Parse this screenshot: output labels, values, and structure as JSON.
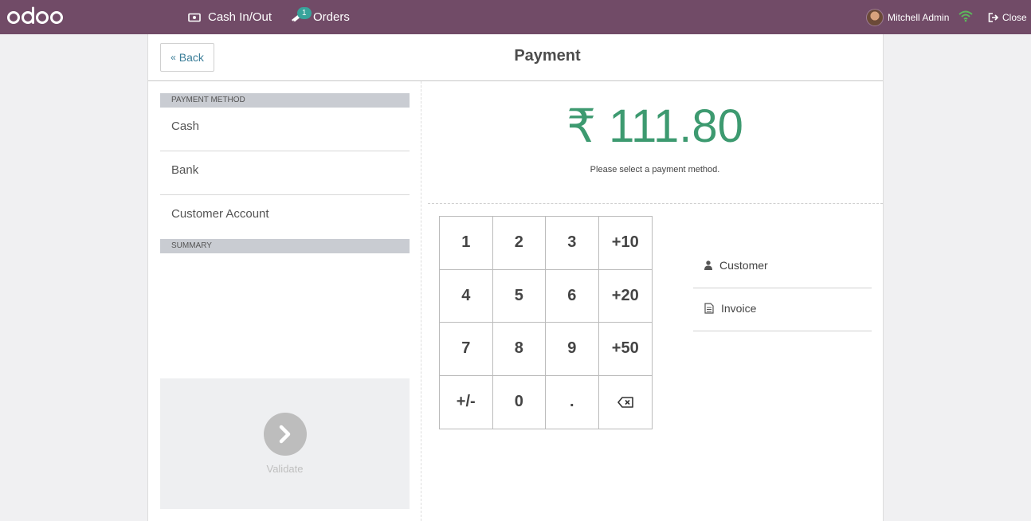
{
  "topbar": {
    "logo_text": "odoo",
    "cash_label": "Cash In/Out",
    "orders_label": "Orders",
    "orders_count": "1",
    "user_name": "Mitchell Admin",
    "close_label": "Close"
  },
  "payment": {
    "back_label": "Back",
    "title": "Payment",
    "payment_method_header": "PAYMENT METHOD",
    "methods": [
      "Cash",
      "Bank",
      "Customer Account"
    ],
    "summary_header": "SUMMARY",
    "validate_label": "Validate",
    "amount": "₹ 111.80",
    "hint": "Please select a payment method.",
    "customer_label": "Customer",
    "invoice_label": "Invoice"
  },
  "numpad": {
    "keys": [
      "1",
      "2",
      "3",
      "+10",
      "4",
      "5",
      "6",
      "+20",
      "7",
      "8",
      "9",
      "+50",
      "+/-",
      "0",
      "."
    ]
  },
  "colors": {
    "topbar": "#714b67",
    "amount": "#3d9a70",
    "badge": "#38a39b"
  }
}
